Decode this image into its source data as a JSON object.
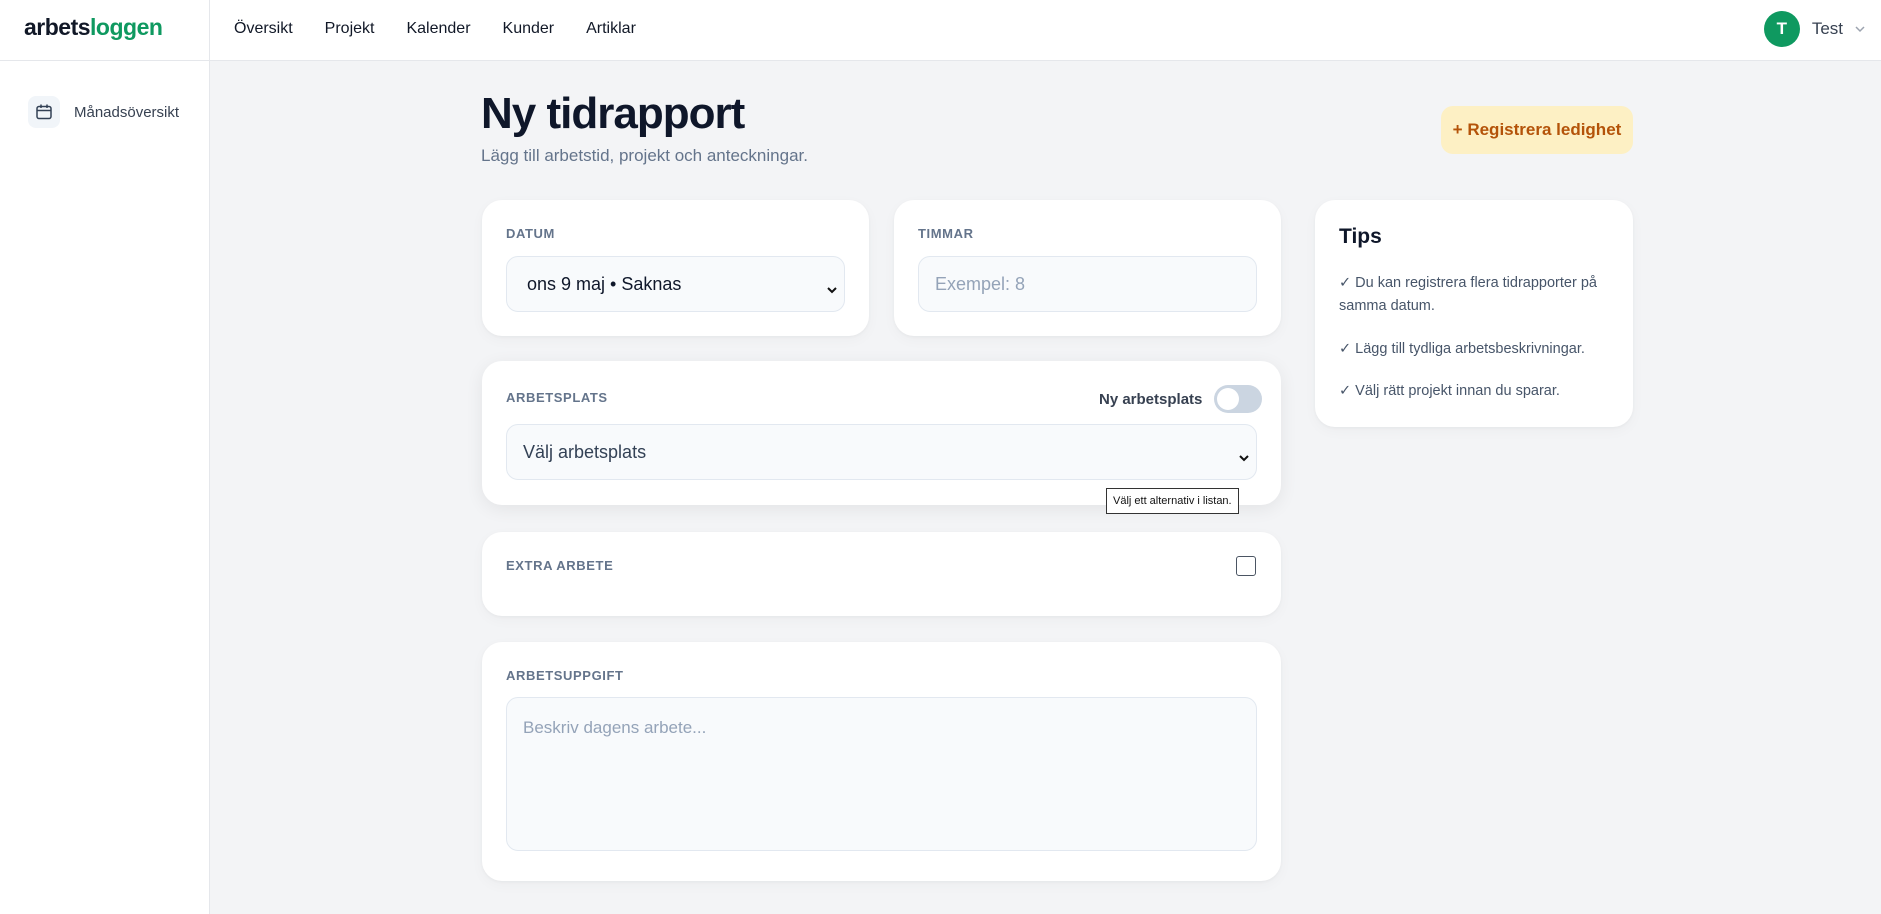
{
  "header": {
    "logo_part1": "arbets",
    "logo_part2": "loggen",
    "nav": [
      "Översikt",
      "Projekt",
      "Kalender",
      "Kunder",
      "Artiklar"
    ],
    "user": {
      "initial": "T",
      "name": "Test"
    }
  },
  "sidebar": {
    "items": [
      {
        "label": "Månadsöversikt",
        "icon": "calendar-icon"
      }
    ]
  },
  "page": {
    "title": "Ny tidrapport",
    "subtitle": "Lägg till arbetstid, projekt och anteckningar.",
    "leave_button": "+ Registrera ledighet"
  },
  "form": {
    "date": {
      "label": "DATUM",
      "value": "ons 9 maj • Saknas"
    },
    "hours": {
      "label": "TIMMAR",
      "placeholder": "Exempel: 8"
    },
    "workplace": {
      "label": "ARBETSPLATS",
      "toggle_label": "Ny arbetsplats",
      "toggle_on": false,
      "value": "Välj arbetsplats",
      "tooltip": "Välj ett alternativ i listan."
    },
    "extra": {
      "label": "EXTRA ARBETE",
      "checked": false
    },
    "task": {
      "label": "ARBETSUPPGIFT",
      "placeholder": "Beskriv dagens arbete..."
    }
  },
  "tips": {
    "title": "Tips",
    "items": [
      "✓ Du kan registrera flera tidrapporter på samma datum.",
      "✓ Lägg till tydliga arbetsbeskrivningar.",
      "✓ Välj rätt projekt innan du sparar."
    ]
  },
  "colors": {
    "brand_green": "#0f9960",
    "leave_bg": "#fdf0c4",
    "leave_text": "#b45309"
  }
}
